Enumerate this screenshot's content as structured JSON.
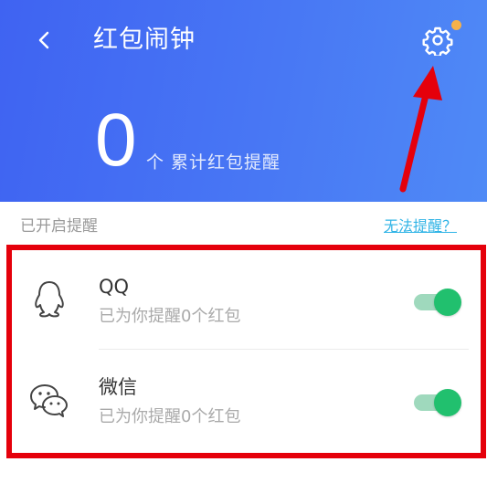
{
  "header": {
    "title": "红包闹钟",
    "count": "0",
    "count_label": "个 累计红包提醒",
    "colors": {
      "gradient_start": "#3f63f2",
      "gradient_end": "#4f8af6",
      "badge": "#f5b14a"
    },
    "icons": {
      "back": "chevron-left-icon",
      "settings": "gear-icon"
    }
  },
  "section": {
    "label": "已开启提醒",
    "help_link": "无法提醒？"
  },
  "apps": [
    {
      "name": "QQ",
      "subtitle": "已为你提醒0个红包",
      "enabled": true,
      "icon": "qq-penguin-icon"
    },
    {
      "name": "微信",
      "subtitle": "已为你提醒0个红包",
      "enabled": true,
      "icon": "wechat-icon"
    }
  ],
  "annotation": {
    "highlight_color": "#e5000b"
  },
  "toggle_colors": {
    "on_knob": "#21c06e",
    "on_track": "#9fd9bd"
  }
}
